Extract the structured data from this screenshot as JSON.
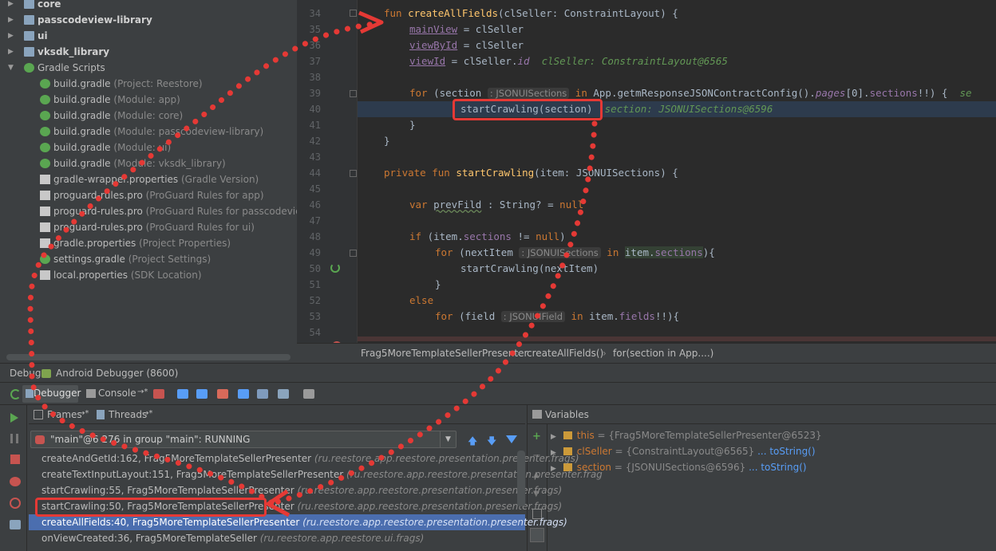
{
  "project_tree": {
    "items": [
      {
        "label": "core",
        "hint": "",
        "type": "folder",
        "bold": true,
        "arrow": "▶"
      },
      {
        "label": "passcodeview-library",
        "hint": "",
        "type": "folder",
        "bold": true,
        "arrow": "▶"
      },
      {
        "label": "ui",
        "hint": "",
        "type": "folder",
        "bold": true,
        "arrow": "▶"
      },
      {
        "label": "vksdk_library",
        "hint": "",
        "type": "folder",
        "bold": true,
        "arrow": "▶"
      },
      {
        "label": "Gradle Scripts",
        "hint": "",
        "type": "gradle",
        "bold": false,
        "arrow": "▼"
      },
      {
        "label": "build.gradle",
        "hint": "(Project: Reestore)",
        "type": "gradle",
        "bold": false,
        "arrow": ""
      },
      {
        "label": "build.gradle",
        "hint": "(Module: app)",
        "type": "gradle",
        "bold": false,
        "arrow": ""
      },
      {
        "label": "build.gradle",
        "hint": "(Module: core)",
        "type": "gradle",
        "bold": false,
        "arrow": ""
      },
      {
        "label": "build.gradle",
        "hint": "(Module: passcodeview-library)",
        "type": "gradle",
        "bold": false,
        "arrow": ""
      },
      {
        "label": "build.gradle",
        "hint": "(Module: ui)",
        "type": "gradle",
        "bold": false,
        "arrow": ""
      },
      {
        "label": "build.gradle",
        "hint": "(Module: vksdk_library)",
        "type": "gradle",
        "bold": false,
        "arrow": ""
      },
      {
        "label": "gradle-wrapper.properties",
        "hint": "(Gradle Version)",
        "type": "file",
        "bold": false,
        "arrow": ""
      },
      {
        "label": "proguard-rules.pro",
        "hint": "(ProGuard Rules for app)",
        "type": "file",
        "bold": false,
        "arrow": ""
      },
      {
        "label": "proguard-rules.pro",
        "hint": "(ProGuard Rules for passcodeview-libr",
        "type": "file",
        "bold": false,
        "arrow": ""
      },
      {
        "label": "proguard-rules.pro",
        "hint": "(ProGuard Rules for ui)",
        "type": "file",
        "bold": false,
        "arrow": ""
      },
      {
        "label": "gradle.properties",
        "hint": "(Project Properties)",
        "type": "file",
        "bold": false,
        "arrow": ""
      },
      {
        "label": "settings.gradle",
        "hint": "(Project Settings)",
        "type": "gradle",
        "bold": false,
        "arrow": ""
      },
      {
        "label": "local.properties",
        "hint": "(SDK Location)",
        "type": "file",
        "bold": false,
        "arrow": ""
      }
    ]
  },
  "editor": {
    "line_numbers": [
      "34",
      "35",
      "36",
      "37",
      "38",
      "39",
      "40",
      "41",
      "42",
      "43",
      "44",
      "45",
      "46",
      "47",
      "48",
      "49",
      "50",
      "51",
      "52",
      "53",
      "54"
    ],
    "code": {
      "l34_kw": "fun ",
      "l34_fn": "createAllFields",
      "l34_rest": "(clSeller: ConstraintLayout) {",
      "l35_pr": "mainView",
      "l35_rest": " = clSeller",
      "l36_pr": "viewById",
      "l36_rest": " = clSeller",
      "l37_pr": "viewId",
      "l37_mid": " = clSeller.",
      "l37_pr2": "id",
      "l37_dbg": "clSeller: ConstraintLayout@6565",
      "l39_kw": "for ",
      "l39_a": "(section",
      "l39_inlay": ": JSONUISections",
      "l39_in": " in ",
      "l39_b": "App.getmResponseJSONContractConfig().",
      "l39_pr": "pages",
      "l39_c": "[0].",
      "l39_pr2": "sections",
      "l39_d": "!!) {",
      "l39_dbg": "se",
      "l40_call": "startCrawling(section)",
      "l40_dbg": "section: JSONUISections@6596",
      "l41": "}",
      "l42": "}",
      "l44_kw": "private fun ",
      "l44_fn": "startCrawling",
      "l44_rest": "(item: JSONUISections) {",
      "l46_kw": "var ",
      "l46_var": "prevFild",
      "l46_rest": " : String? = ",
      "l46_null": "null",
      "l48_kw": "if ",
      "l48_a": "(item.",
      "l48_pr": "sections",
      "l48_b": " != ",
      "l48_null": "null",
      ")": ")",
      "l49_kw": "for ",
      "l49_a": "(nextItem",
      "l49_inlay": ": JSONUISections",
      "l49_in": " in ",
      "l49_b": "item.",
      "l49_pr": "sections",
      "l49_c": "){",
      "l50": "startCrawling(nextItem)",
      "l51": "}",
      "l52_kw": "else",
      "l53_kw": "for ",
      "l53_a": "(field",
      "l53_inlay": ": JSONUIField",
      "l53_in": " in ",
      "l53_b": "item.",
      "l53_pr": "fields",
      "l53_c": "!!){"
    },
    "breadcrumb": [
      "Frag5MoreTemplateSellerPresenter",
      "createAllFields()",
      "for(section in App....)"
    ]
  },
  "debug": {
    "title_debug": "Debug",
    "title_config": "Android Debugger (8600)",
    "tab_debugger": "Debugger",
    "tab_console": "Console",
    "tab_console_suffix": "→*",
    "frames_label": "Frames",
    "frames_suffix": "→*",
    "threads_label": "Threads",
    "threads_suffix": "→*",
    "thread_select": "\"main\"@6 276 in group \"main\": RUNNING",
    "frames": [
      {
        "method": "createAndGetId:162, Frag5MoreTemplateSellerPresenter",
        "pkg": "(ru.reestore.app.reestore.presentation.presenter.frags)",
        "selected": false
      },
      {
        "method": "createTextInputLayout:151, Frag5MoreTemplateSellerPresenter",
        "pkg": "(ru.reestore.app.reestore.presentation.presenter.frag",
        "selected": false
      },
      {
        "method": "startCrawling:55, Frag5MoreTemplateSellerPresenter",
        "pkg": "(ru.reestore.app.reestore.presentation.presenter.frags)",
        "selected": false
      },
      {
        "method": "startCrawling:50, Frag5MoreTemplateSellerPresenter",
        "pkg": "(ru.reestore.app.reestore.presentation.presenter.frags)",
        "selected": false
      },
      {
        "method": "createAllFields:40, Frag5MoreTemplateSellerPresenter",
        "pkg": "(ru.reestore.app.reestore.presentation.presenter.frags)",
        "selected": true
      },
      {
        "method": "onViewCreated:36, Frag5MoreTemplateSeller",
        "pkg": "(ru.reestore.app.reestore.ui.frags)",
        "selected": false
      }
    ],
    "variables_label": "Variables",
    "variables": [
      {
        "name": "this",
        "value": "= {Frag5MoreTemplateSellerPresenter@6523}",
        "link": ""
      },
      {
        "name": "clSeller",
        "value": "= {ConstraintLayout@6565}",
        "link": "... toString()"
      },
      {
        "name": "section",
        "value": "= {JSONUISections@6596}",
        "link": "... toString()"
      }
    ]
  },
  "colors": {
    "annotation": "#e53935",
    "selection": "#4b6eaf",
    "keyword": "#cc7832",
    "function": "#ffc66d",
    "property": "#9876aa",
    "debug_value": "#629755"
  }
}
